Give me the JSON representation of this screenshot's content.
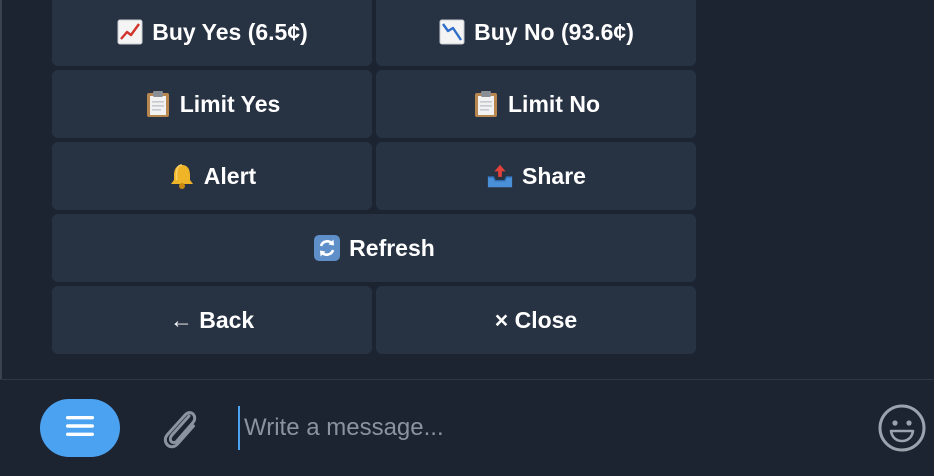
{
  "keyboard": {
    "rows": [
      [
        {
          "label": "Buy Yes (6.5¢)",
          "icon": "chart-increasing-icon"
        },
        {
          "label": "Buy No (93.6¢)",
          "icon": "chart-decreasing-icon"
        }
      ],
      [
        {
          "label": "Limit Yes",
          "icon": "clipboard-icon"
        },
        {
          "label": "Limit No",
          "icon": "clipboard-icon"
        }
      ],
      [
        {
          "label": "Alert",
          "icon": "bell-icon"
        },
        {
          "label": "Share",
          "icon": "outbox-tray-icon"
        }
      ],
      [
        {
          "label": "Refresh",
          "icon": "arrows-cycle-icon"
        }
      ],
      [
        {
          "label": "← Back",
          "icon": ""
        },
        {
          "label": "× Close",
          "icon": ""
        }
      ]
    ]
  },
  "composer": {
    "placeholder": "Write a message...",
    "value": ""
  },
  "colors": {
    "background": "#1c2331",
    "button": "#273243",
    "accent": "#4aa2f0",
    "text": "#ffffff",
    "placeholder": "#8a939f"
  }
}
